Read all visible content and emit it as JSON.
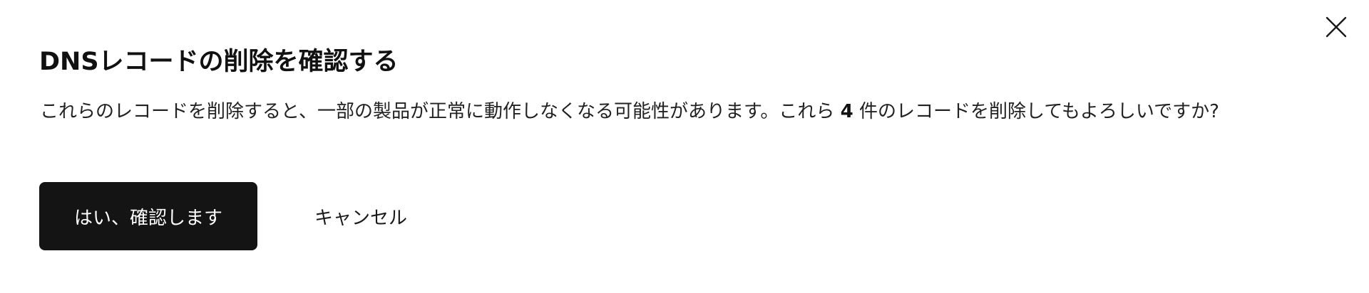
{
  "dialog": {
    "title": "DNSレコードの削除を確認する",
    "message_before": "これらのレコードを削除すると、一部の製品が正常に動作しなくなる可能性があります。これら",
    "record_count": "4",
    "message_after": "件のレコードを削除してもよろしいですか?",
    "confirm_label": "はい、確認します",
    "cancel_label": "キャンセル",
    "close_icon": "close-icon"
  },
  "colors": {
    "confirm_bg": "#141414",
    "confirm_text": "#ffffff",
    "text": "#1a1a1a"
  }
}
